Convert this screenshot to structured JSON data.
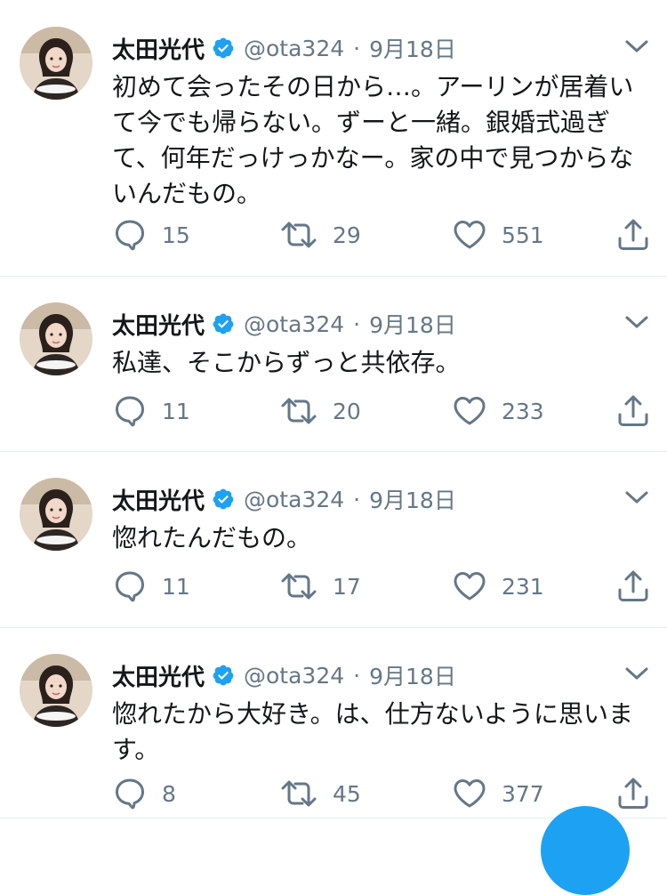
{
  "theme": {
    "accent": "#1da1f2",
    "muted": "#657786",
    "text": "#14171a",
    "divider": "#e6ecf0"
  },
  "icons": {
    "verified": "verified-badge-icon",
    "caret": "chevron-down-icon",
    "reply": "reply-icon",
    "retweet": "retweet-icon",
    "like": "heart-icon",
    "share": "share-icon"
  },
  "tweets": [
    {
      "name": "太田光代",
      "handle": "@ota324",
      "separator": "·",
      "date": "9月18日",
      "text": "初めて会ったその日から…。アーリンが居着いて今でも帰らない。ずーと一緒。銀婚式過ぎて、何年だっけっかなー。家の中で見つからないんだもの。",
      "replies": "15",
      "retweets": "29",
      "likes": "551"
    },
    {
      "name": "太田光代",
      "handle": "@ota324",
      "separator": "·",
      "date": "9月18日",
      "text": "私達、そこからずっと共依存。",
      "replies": "11",
      "retweets": "20",
      "likes": "233"
    },
    {
      "name": "太田光代",
      "handle": "@ota324",
      "separator": "·",
      "date": "9月18日",
      "text": "惚れたんだもの。",
      "replies": "11",
      "retweets": "17",
      "likes": "231"
    },
    {
      "name": "太田光代",
      "handle": "@ota324",
      "separator": "·",
      "date": "9月18日",
      "text": "惚れたから大好き。は、仕方ないように思います。",
      "replies": "8",
      "retweets": "45",
      "likes": "377"
    }
  ]
}
